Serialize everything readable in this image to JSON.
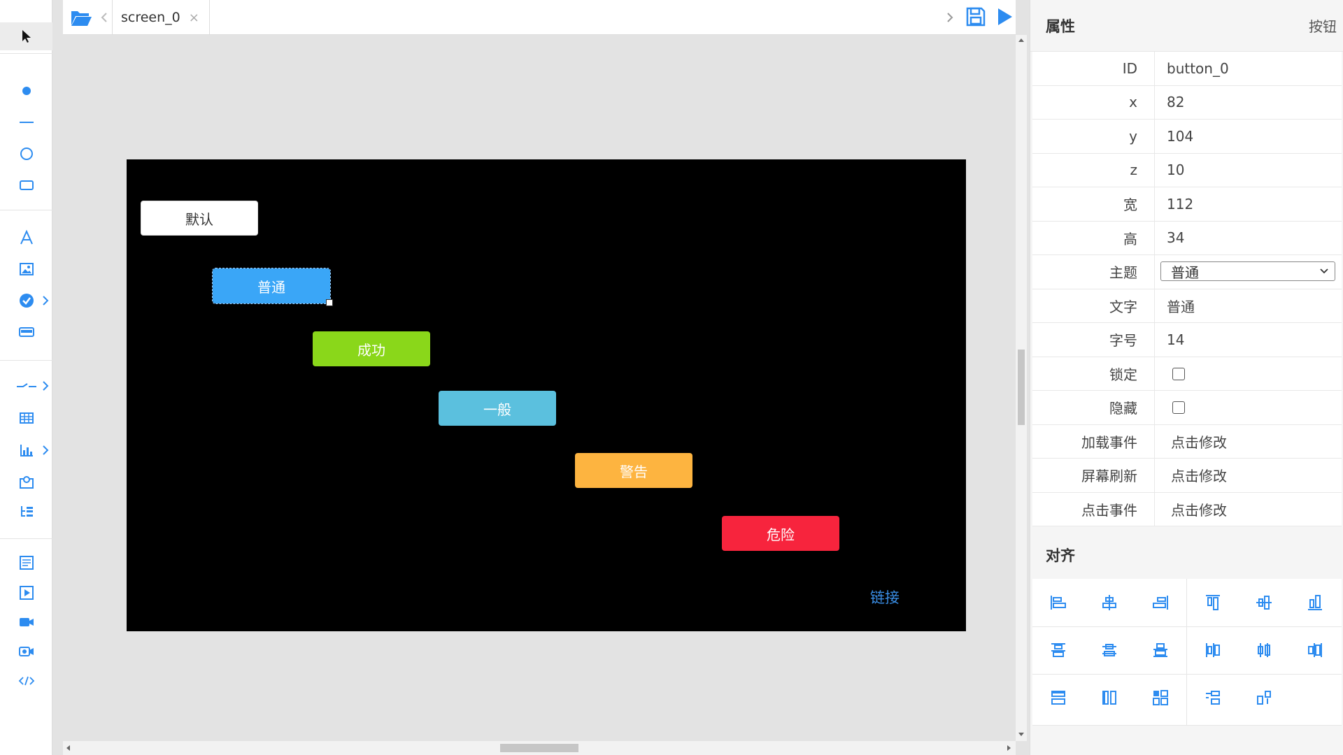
{
  "tab": {
    "name": "screen_0",
    "close": "×"
  },
  "widgets": {
    "default_btn": "默认",
    "normal_btn": "普通",
    "success_btn": "成功",
    "info_btn": "一般",
    "warning_btn": "警告",
    "danger_btn": "危险",
    "link": "链接"
  },
  "panel": {
    "title": "属性",
    "type": "按钮",
    "props": {
      "id": {
        "label": "ID",
        "value": "button_0"
      },
      "x": {
        "label": "x",
        "value": "82"
      },
      "y": {
        "label": "y",
        "value": "104"
      },
      "z": {
        "label": "z",
        "value": "10"
      },
      "width": {
        "label": "宽",
        "value": "112"
      },
      "height": {
        "label": "高",
        "value": "34"
      },
      "theme": {
        "label": "主题",
        "value": "普通"
      },
      "text": {
        "label": "文字",
        "value": "普通"
      },
      "font_size": {
        "label": "字号",
        "value": "14"
      },
      "lock": {
        "label": "锁定"
      },
      "hidden": {
        "label": "隐藏"
      },
      "load_event": {
        "label": "加载事件",
        "value": "点击修改"
      },
      "refresh_event": {
        "label": "屏幕刷新",
        "value": "点击修改"
      },
      "click_event": {
        "label": "点击事件",
        "value": "点击修改"
      }
    },
    "align_title": "对齐"
  },
  "colors": {
    "accent": "#2d8cf0",
    "normal": "#3aa6f7",
    "success": "#8ad71a",
    "info": "#5bc0de",
    "warning": "#fdb440",
    "danger": "#f7243d"
  }
}
